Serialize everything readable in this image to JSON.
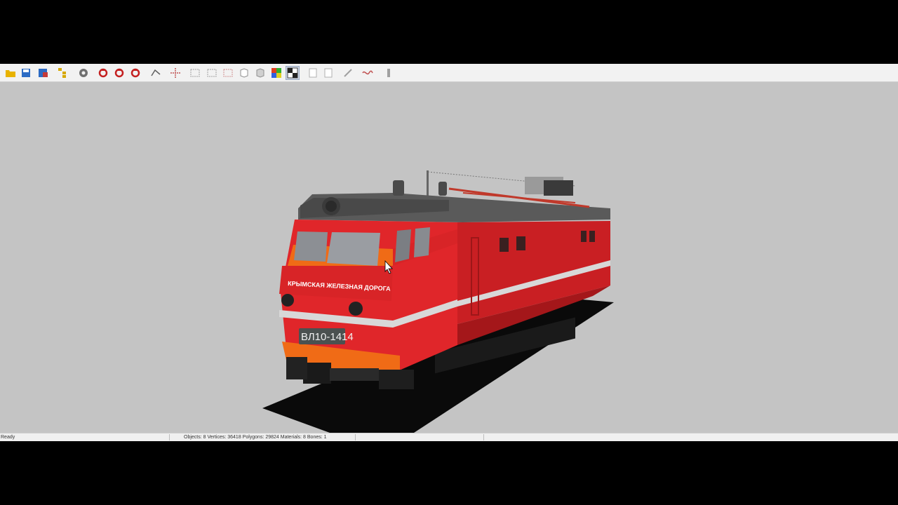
{
  "toolbar": {
    "buttons": [
      {
        "icon": "open-folder-icon",
        "color": "#e8b200"
      },
      {
        "icon": "save-icon",
        "color": "#2c6bc4"
      },
      {
        "icon": "save-as-icon",
        "color": "#c43a3a"
      },
      {
        "icon": "hierarchy-icon",
        "color": "#d6a800"
      },
      {
        "icon": "settings-gear-icon",
        "color": "#707070"
      },
      {
        "icon": "undo-rotate-icon",
        "color": "#c42020"
      },
      {
        "icon": "orbit-icon",
        "color": "#c42020"
      },
      {
        "icon": "move-icon",
        "color": "#c42020"
      },
      {
        "icon": "vertex-tool-icon",
        "color": "#606060"
      },
      {
        "icon": "axes-icon",
        "color": "#c05050"
      },
      {
        "icon": "box-select-icon",
        "color": "#a0a0a0"
      },
      {
        "icon": "box-deselect-icon",
        "color": "#a0a0a0"
      },
      {
        "icon": "box-invert-icon",
        "color": "#d09090"
      },
      {
        "icon": "cube-wireframe-icon",
        "color": "#909090"
      },
      {
        "icon": "cube-solid-icon",
        "color": "#909090"
      },
      {
        "icon": "material-colors-icon",
        "color": "#e04020"
      },
      {
        "icon": "texture-checker-icon",
        "color": "#222222"
      },
      {
        "icon": "page-icon",
        "color": "#b0b0b0"
      },
      {
        "icon": "copy-page-icon",
        "color": "#b0b0b0"
      },
      {
        "icon": "link-icon",
        "color": "#a0a0a0"
      },
      {
        "icon": "curve-icon",
        "color": "#c05050"
      },
      {
        "icon": "bone-icon",
        "color": "#a0a0a0"
      }
    ],
    "active_index": 16
  },
  "viewport": {
    "background": "#c4c4c4",
    "model": {
      "cab_text": "КРЫМСКАЯ ЖЕЛЕЗНАЯ ДОРОГА",
      "number_plate": "ВЛ10-1414",
      "body_color": "#d9262a",
      "accent_color": "#f2731c"
    }
  },
  "status": {
    "state": "Ready",
    "stats": "Objects: 8   Vertices: 36418   Polygons: 29824   Materials: 8   Bones: 1"
  }
}
